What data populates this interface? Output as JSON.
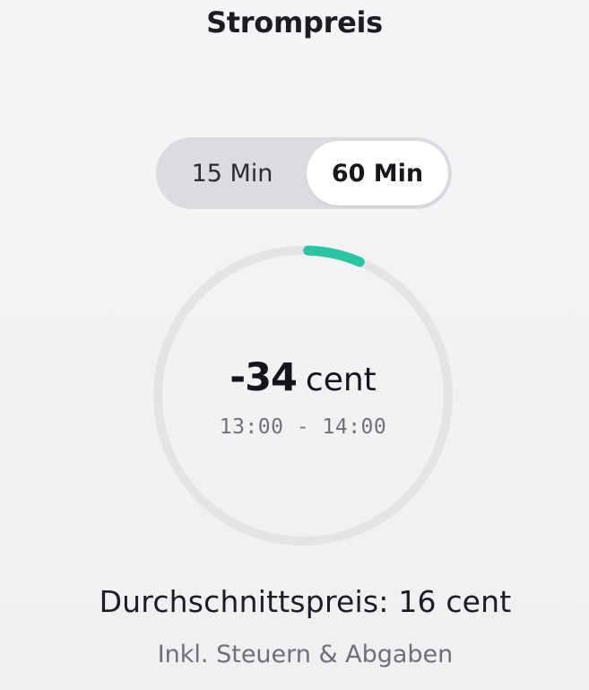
{
  "header": {
    "title": "Strompreis"
  },
  "interval_toggle": {
    "options": [
      "15 Min",
      "60 Min"
    ],
    "selected": "60 Min"
  },
  "gauge": {
    "price_value": "-34",
    "price_unit": "cent",
    "time_range": "13:00 - 14:00",
    "track_color": "#e3e4e6",
    "indicator_color": "#2bc5a4"
  },
  "summary": {
    "average_price": "Durchschnittspreis: 16 cent",
    "tax_note": "Inkl. Steuern & Abgaben"
  }
}
